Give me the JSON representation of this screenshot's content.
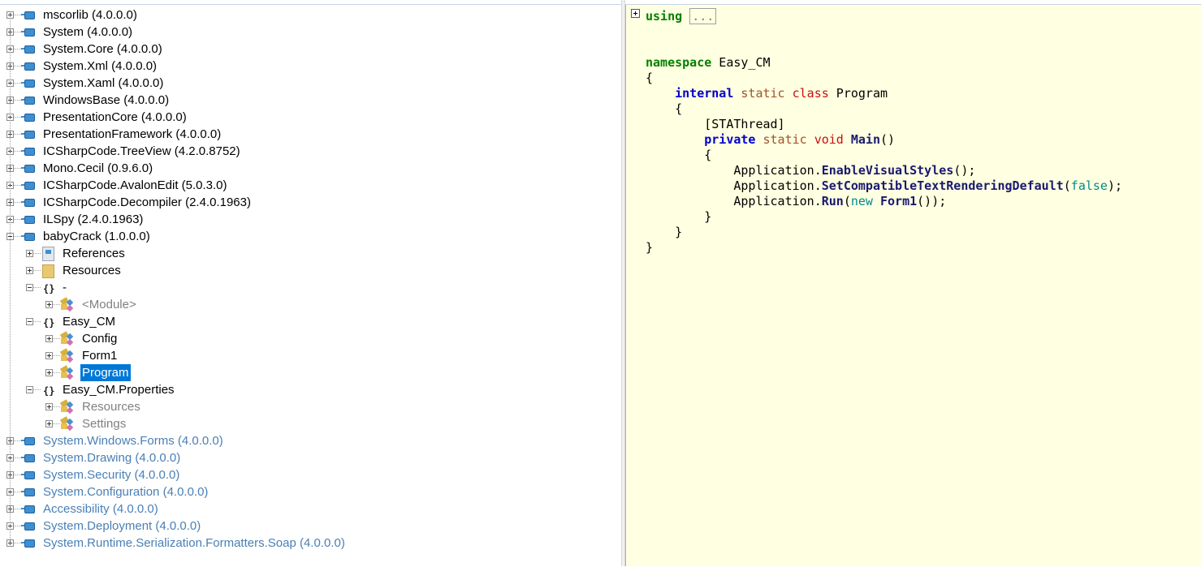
{
  "tree": [
    {
      "level": 0,
      "label": "mscorlib (4.0.0.0)",
      "icon": "assembly-icon",
      "expanded": false
    },
    {
      "level": 0,
      "label": "System (4.0.0.0)",
      "icon": "assembly-icon",
      "expanded": false
    },
    {
      "level": 0,
      "label": "System.Core (4.0.0.0)",
      "icon": "assembly-icon",
      "expanded": false
    },
    {
      "level": 0,
      "label": "System.Xml (4.0.0.0)",
      "icon": "assembly-icon",
      "expanded": false
    },
    {
      "level": 0,
      "label": "System.Xaml (4.0.0.0)",
      "icon": "assembly-icon",
      "expanded": false
    },
    {
      "level": 0,
      "label": "WindowsBase (4.0.0.0)",
      "icon": "assembly-icon",
      "expanded": false
    },
    {
      "level": 0,
      "label": "PresentationCore (4.0.0.0)",
      "icon": "assembly-icon",
      "expanded": false
    },
    {
      "level": 0,
      "label": "PresentationFramework (4.0.0.0)",
      "icon": "assembly-icon",
      "expanded": false
    },
    {
      "level": 0,
      "label": "ICSharpCode.TreeView (4.2.0.8752)",
      "icon": "assembly-icon",
      "expanded": false
    },
    {
      "level": 0,
      "label": "Mono.Cecil (0.9.6.0)",
      "icon": "assembly-icon",
      "expanded": false
    },
    {
      "level": 0,
      "label": "ICSharpCode.AvalonEdit (5.0.3.0)",
      "icon": "assembly-icon",
      "expanded": false
    },
    {
      "level": 0,
      "label": "ICSharpCode.Decompiler (2.4.0.1963)",
      "icon": "assembly-icon",
      "expanded": false
    },
    {
      "level": 0,
      "label": "ILSpy (2.4.0.1963)",
      "icon": "assembly-icon",
      "expanded": false
    },
    {
      "level": 0,
      "label": "babyCrack (1.0.0.0)",
      "icon": "assembly-icon",
      "expanded": true
    },
    {
      "level": 1,
      "label": "References",
      "icon": "references-icon",
      "expanded": false
    },
    {
      "level": 1,
      "label": "Resources",
      "icon": "folder-icon",
      "expanded": false
    },
    {
      "level": 1,
      "label": "-",
      "icon": "namespace-icon",
      "expanded": true
    },
    {
      "level": 2,
      "label": "<Module>",
      "icon": "class-icon",
      "expanded": false,
      "style": "dim"
    },
    {
      "level": 1,
      "label": "Easy_CM",
      "icon": "namespace-icon",
      "expanded": true
    },
    {
      "level": 2,
      "label": "Config",
      "icon": "class-icon",
      "expanded": false
    },
    {
      "level": 2,
      "label": "Form1",
      "icon": "class-icon",
      "expanded": false
    },
    {
      "level": 2,
      "label": "Program",
      "icon": "class-icon",
      "expanded": false,
      "selected": true
    },
    {
      "level": 1,
      "label": "Easy_CM.Properties",
      "icon": "namespace-icon",
      "expanded": true
    },
    {
      "level": 2,
      "label": "Resources",
      "icon": "class-icon",
      "expanded": false,
      "style": "dim"
    },
    {
      "level": 2,
      "label": "Settings",
      "icon": "class-icon",
      "expanded": false,
      "style": "dim"
    },
    {
      "level": 0,
      "label": "System.Windows.Forms (4.0.0.0)",
      "icon": "assembly-icon",
      "expanded": false,
      "style": "blue"
    },
    {
      "level": 0,
      "label": "System.Drawing (4.0.0.0)",
      "icon": "assembly-icon",
      "expanded": false,
      "style": "blue"
    },
    {
      "level": 0,
      "label": "System.Security (4.0.0.0)",
      "icon": "assembly-icon",
      "expanded": false,
      "style": "blue"
    },
    {
      "level": 0,
      "label": "System.Configuration (4.0.0.0)",
      "icon": "assembly-icon",
      "expanded": false,
      "style": "blue"
    },
    {
      "level": 0,
      "label": "Accessibility (4.0.0.0)",
      "icon": "assembly-icon",
      "expanded": false,
      "style": "blue"
    },
    {
      "level": 0,
      "label": "System.Deployment (4.0.0.0)",
      "icon": "assembly-icon",
      "expanded": false,
      "style": "blue"
    },
    {
      "level": 0,
      "label": "System.Runtime.Serialization.Formatters.Soap (4.0.0.0)",
      "icon": "assembly-icon",
      "expanded": false,
      "style": "blue"
    }
  ],
  "code": {
    "using_keyword": "using",
    "using_collapsed": "...",
    "lines": [
      [],
      [
        {
          "t": "namespace",
          "c": "green"
        },
        {
          "t": " Easy_CM",
          "c": "plain"
        }
      ],
      [
        {
          "t": "{",
          "c": "plain"
        }
      ],
      [
        {
          "t": "    ",
          "c": "plain"
        },
        {
          "t": "internal",
          "c": "blue"
        },
        {
          "t": " ",
          "c": "plain"
        },
        {
          "t": "static",
          "c": "mod"
        },
        {
          "t": " ",
          "c": "plain"
        },
        {
          "t": "class",
          "c": "red"
        },
        {
          "t": " Program",
          "c": "plain"
        }
      ],
      [
        {
          "t": "    {",
          "c": "plain"
        }
      ],
      [
        {
          "t": "        [STAThread]",
          "c": "plain"
        }
      ],
      [
        {
          "t": "        ",
          "c": "plain"
        },
        {
          "t": "private",
          "c": "blue"
        },
        {
          "t": " ",
          "c": "plain"
        },
        {
          "t": "static",
          "c": "mod"
        },
        {
          "t": " ",
          "c": "plain"
        },
        {
          "t": "void",
          "c": "red"
        },
        {
          "t": " ",
          "c": "plain"
        },
        {
          "t": "Main",
          "c": "method"
        },
        {
          "t": "()",
          "c": "plain"
        }
      ],
      [
        {
          "t": "        {",
          "c": "plain"
        }
      ],
      [
        {
          "t": "            Application.",
          "c": "plain"
        },
        {
          "t": "EnableVisualStyles",
          "c": "method"
        },
        {
          "t": "();",
          "c": "plain"
        }
      ],
      [
        {
          "t": "            Application.",
          "c": "plain"
        },
        {
          "t": "SetCompatibleTextRenderingDefault",
          "c": "method"
        },
        {
          "t": "(",
          "c": "plain"
        },
        {
          "t": "false",
          "c": "teal"
        },
        {
          "t": ");",
          "c": "plain"
        }
      ],
      [
        {
          "t": "            Application.",
          "c": "plain"
        },
        {
          "t": "Run",
          "c": "method"
        },
        {
          "t": "(",
          "c": "plain"
        },
        {
          "t": "new",
          "c": "teal"
        },
        {
          "t": " ",
          "c": "plain"
        },
        {
          "t": "Form1",
          "c": "method"
        },
        {
          "t": "());",
          "c": "plain"
        }
      ],
      [
        {
          "t": "        }",
          "c": "plain"
        }
      ],
      [
        {
          "t": "    }",
          "c": "plain"
        }
      ],
      [
        {
          "t": "}",
          "c": "plain"
        }
      ]
    ]
  }
}
